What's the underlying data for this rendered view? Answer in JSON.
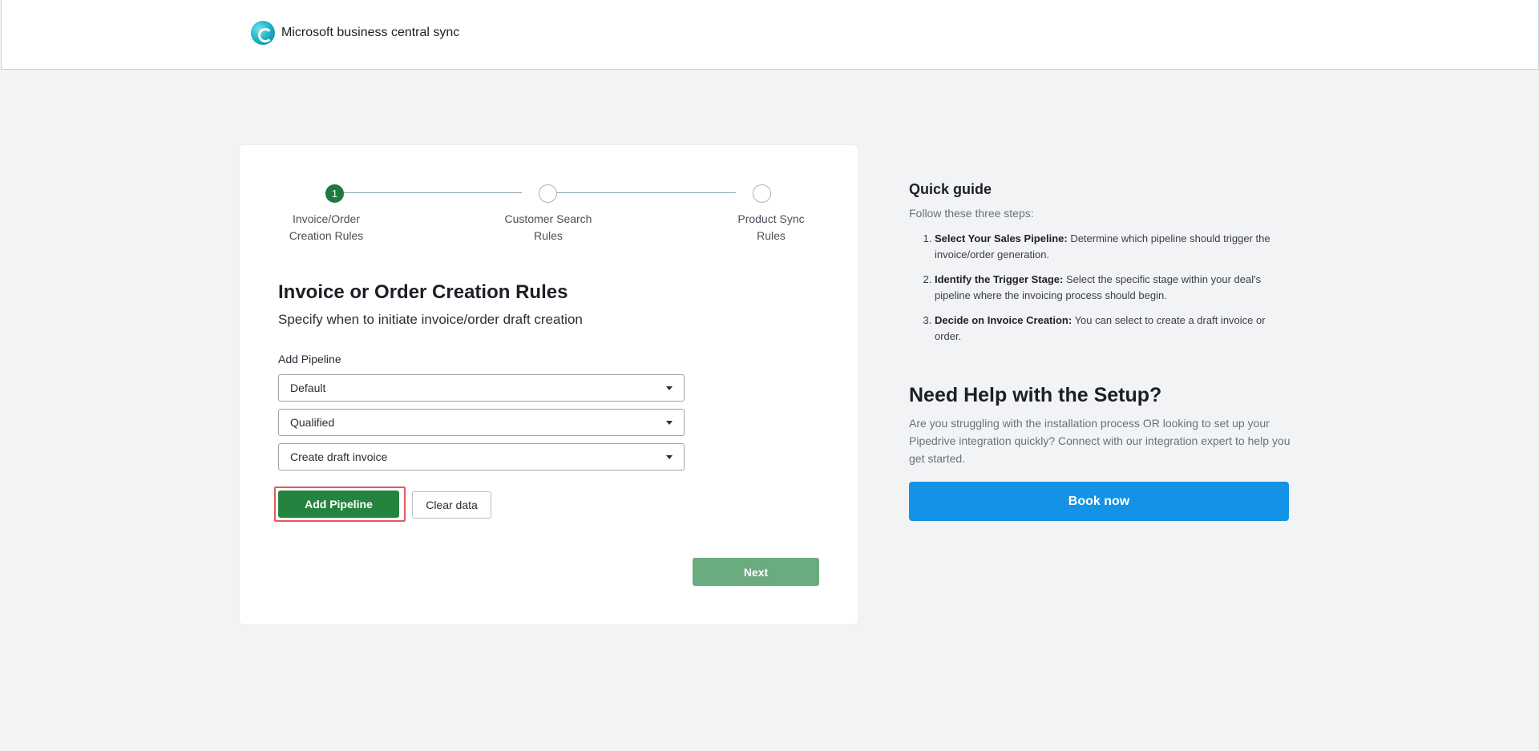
{
  "header": {
    "app_title": "Microsoft business central sync",
    "logo_icon": "business-central-logo-icon"
  },
  "stepper": {
    "steps": [
      {
        "number": "1",
        "label_line1": "Invoice/Order",
        "label_line2": "Creation Rules",
        "state": "active"
      },
      {
        "number": "",
        "label_line1": "Customer Search",
        "label_line2": "Rules",
        "state": "pending"
      },
      {
        "number": "",
        "label_line1": "Product Sync",
        "label_line2": "Rules",
        "state": "pending"
      }
    ]
  },
  "form": {
    "title": "Invoice or Order Creation Rules",
    "subtitle": "Specify when to initiate invoice/order draft creation",
    "field_label": "Add Pipeline",
    "pipeline_select": "Default",
    "stage_select": "Qualified",
    "action_select": "Create draft invoice",
    "add_button": "Add Pipeline",
    "clear_button": "Clear data",
    "next_button": "Next"
  },
  "guide": {
    "title": "Quick guide",
    "intro": "Follow these three steps:",
    "steps": [
      {
        "bold": "Select Your Sales Pipeline:",
        "text": " Determine which pipeline should trigger the invoice/order generation."
      },
      {
        "bold": "Identify the Trigger Stage:",
        "text": " Select the specific stage within your deal's pipeline where the invoicing process should begin."
      },
      {
        "bold": "Decide on Invoice Creation:",
        "text": " You can select to create a draft invoice or order."
      }
    ]
  },
  "help": {
    "title": "Need Help with the Setup?",
    "text": "Are you struggling with the installation process OR looking to set up your Pipedrive integration quickly? Connect with our integration expert to help you get started.",
    "book_button": "Book now"
  },
  "colors": {
    "primary_green": "#24843f",
    "accent_blue": "#1492e6",
    "highlight_red": "#e25a5a"
  }
}
